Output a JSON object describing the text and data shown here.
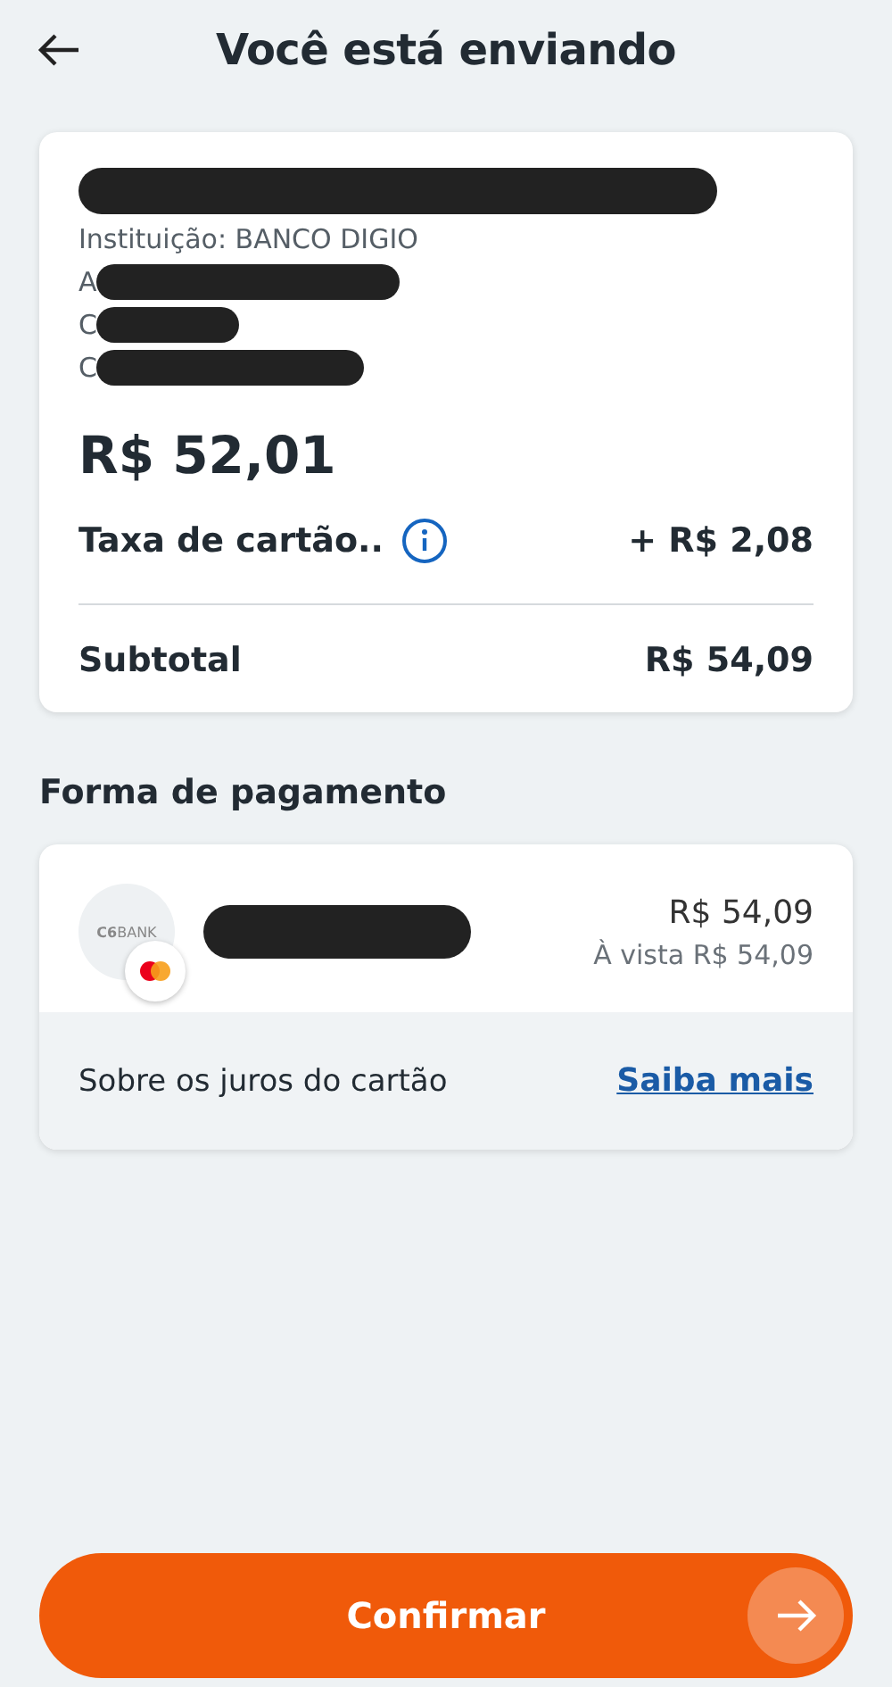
{
  "header": {
    "title": "Você está enviando"
  },
  "recipient": {
    "lines": [
      {
        "kind": "redacted"
      },
      {
        "kind": "text",
        "text": "Instituição: BANCO DIGIO"
      },
      {
        "kind": "partial",
        "text": "A"
      },
      {
        "kind": "partial",
        "text": "C"
      },
      {
        "kind": "partial",
        "text": "C"
      }
    ]
  },
  "amount": "R$ 52,01",
  "fee": {
    "label": "Taxa de cartão..",
    "value": "+ R$ 2,08"
  },
  "subtotal": {
    "label": "Subtotal",
    "value": "R$ 54,09"
  },
  "payment": {
    "section_title": "Forma de pagamento",
    "logo": "**C6**BANK",
    "amount": "R$ 54,09",
    "installment": "À vista R$ 54,09",
    "footer_text": "Sobre os juros do cartão",
    "link": "Saiba mais"
  },
  "confirm_button": "Confirmar"
}
